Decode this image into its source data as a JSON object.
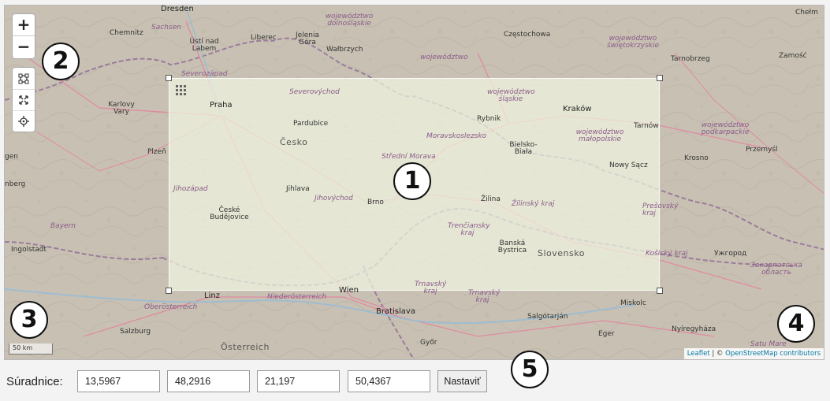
{
  "map": {
    "labels": {
      "dresden": "Dresden",
      "chemnitz": "Chemnitz",
      "sachsen": "Sachsen",
      "usti": "Ústí nad Labem",
      "liberec": "Liberec",
      "jelenia": "Jelenia Góra",
      "walbrzych": "Wałbrzych",
      "dolnoslaskie": "województwo dolnośląskie",
      "czestochowa": "Częstochowa",
      "swietokrzyskie": "województwo świętokrzyskie",
      "chelm": "Chełm",
      "tarnobrzeg": "Tarnobrzeg",
      "zamosc": "Zamość",
      "opolskie": "województwo",
      "severozapad": "Severozápad",
      "praha": "Praha",
      "karlovy": "Karlovy Vary",
      "severovychod": "Severovýchod",
      "slaskie": "województwo śląskie",
      "krakow": "Kraków",
      "rybnik": "Rybnik",
      "tarnow": "Tarnów",
      "pardubice": "Pardubice",
      "moravskoslezsko": "Moravskoslezsko",
      "cesko": "Česko",
      "plzen": "Plzeň",
      "podkarpackie": "województwo podkarpackie",
      "malopolskie": "województwo małopolskie",
      "bielsko": "Bielsko-Biała",
      "krosno": "Krosno",
      "przemysl": "Przemyśl",
      "nowysacz": "Nowy Sącz",
      "strednimorava": "Střední Morava",
      "jen": "gen",
      "nberg": "nberg",
      "jihozapad": "Jihozápad",
      "jihlava": "Jihlava",
      "jihovychod": "Jihovýchod",
      "brno": "Brno",
      "zilina": "Žilina",
      "zilinsky": "Žilinský kraj",
      "presovsky": "Prešovský kraj",
      "budejovice": "České Budějovice",
      "bayern": "Bayern",
      "ingolstadt": "Ingolstadt",
      "trenciansky": "Trenčiansky kraj",
      "bystrica": "Banská Bystrica",
      "slovensko": "Slovensko",
      "kosicky": "Košický kraj",
      "uzhorod": "Ужгород",
      "zakarpatska": "Закарпатська область",
      "linz": "Linz",
      "oberosterreich": "Oberösterreich",
      "niederosterreich": "Niederösterreich",
      "wien": "Wien",
      "trnavsky": "Trnavský kraj",
      "trnavsky2": "Trnavský kraj",
      "bratislava": "Bratislava",
      "miskolc": "Miskolc",
      "salgotarjan": "Salgótarján",
      "nyiregyhaza": "Nyíregyháza",
      "eger": "Eger",
      "salzburg": "Salzburg",
      "osterreich": "Österreich",
      "gyor": "Győr",
      "satumare": "Satu Mare"
    },
    "zoom_in": "+",
    "zoom_out": "−",
    "scale": "50 km",
    "attribution_leaflet": "Leaflet",
    "attribution_sep": " | © ",
    "attribution_osm": "OpenStreetMap contributors",
    "tool_icons": [
      "bounding-box-icon",
      "fullscreen-icon",
      "locate-icon"
    ]
  },
  "badges": [
    "1",
    "2",
    "3",
    "4",
    "5"
  ],
  "coords": {
    "label": "Súradnice:",
    "values": [
      "13,5967",
      "48,2916",
      "21,197",
      "50,4367"
    ],
    "submit": "Nastaviť"
  },
  "colors": {
    "selection_fill": "#eef3dc",
    "region_label": "#8a5a8a",
    "border": "#9b7b9b",
    "road": "#e08aa0"
  }
}
